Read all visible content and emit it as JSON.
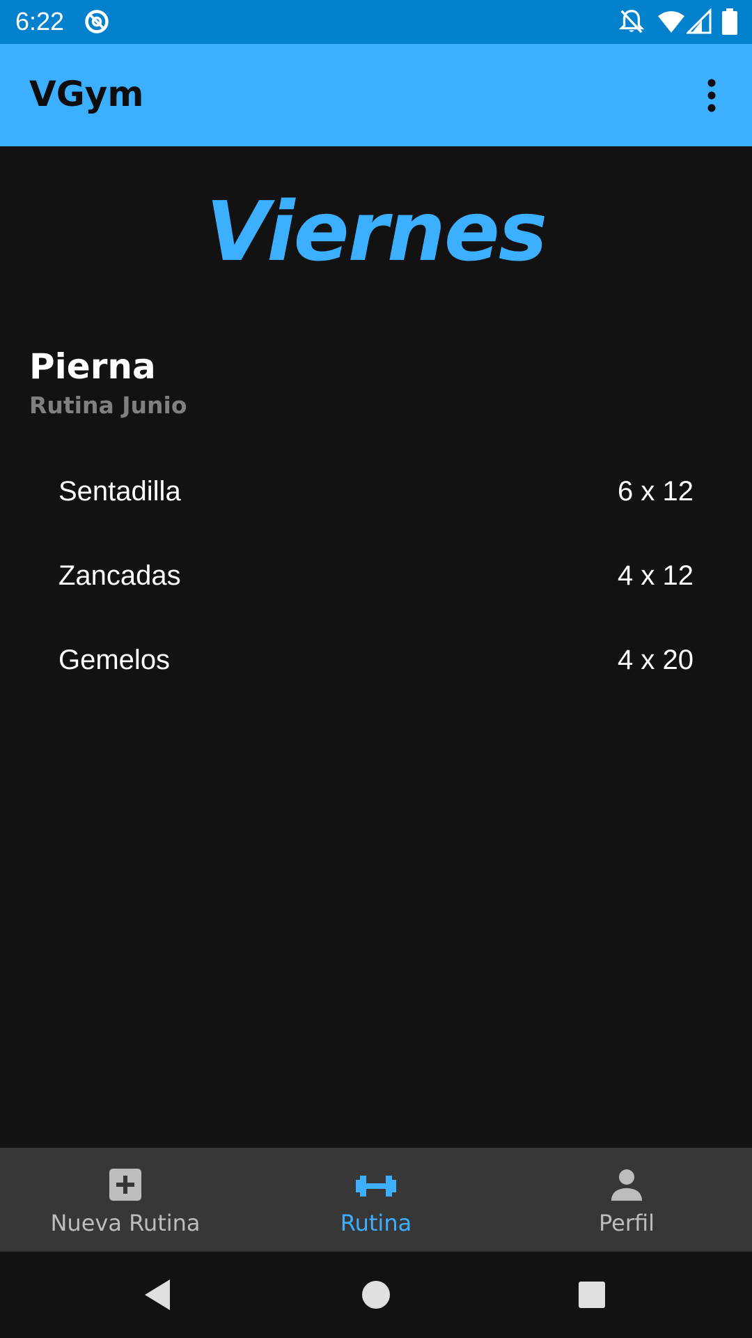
{
  "status_bar": {
    "time": "6:22",
    "background": "#0381CD",
    "icons": [
      "sync-icon",
      "notifications-off-icon",
      "wifi-icon",
      "cell-signal-icon",
      "battery-icon"
    ]
  },
  "app_bar": {
    "title": "VGym",
    "background": "#3DAFFF",
    "menu_icon": "more-vert-icon"
  },
  "main": {
    "day": "Viernes",
    "day_color": "#3DAFFF",
    "routine": {
      "name": "Pierna",
      "subtitle": "Rutina Junio"
    },
    "exercises": [
      {
        "name": "Sentadilla",
        "sets": "6 x 12"
      },
      {
        "name": "Zancadas",
        "sets": "4 x 12"
      },
      {
        "name": "Gemelos",
        "sets": "4 x 20"
      }
    ]
  },
  "bottom_nav": {
    "background": "#373737",
    "active_color": "#3DAFFF",
    "inactive_color": "#BDBDBD",
    "items": [
      {
        "label": "Nueva Rutina",
        "icon": "add-box-icon",
        "active": false
      },
      {
        "label": "Rutina",
        "icon": "fitness-center-icon",
        "active": true
      },
      {
        "label": "Perfil",
        "icon": "person-icon",
        "active": false
      }
    ]
  },
  "system_nav": {
    "buttons": [
      "back-icon",
      "home-icon",
      "recents-icon"
    ]
  }
}
